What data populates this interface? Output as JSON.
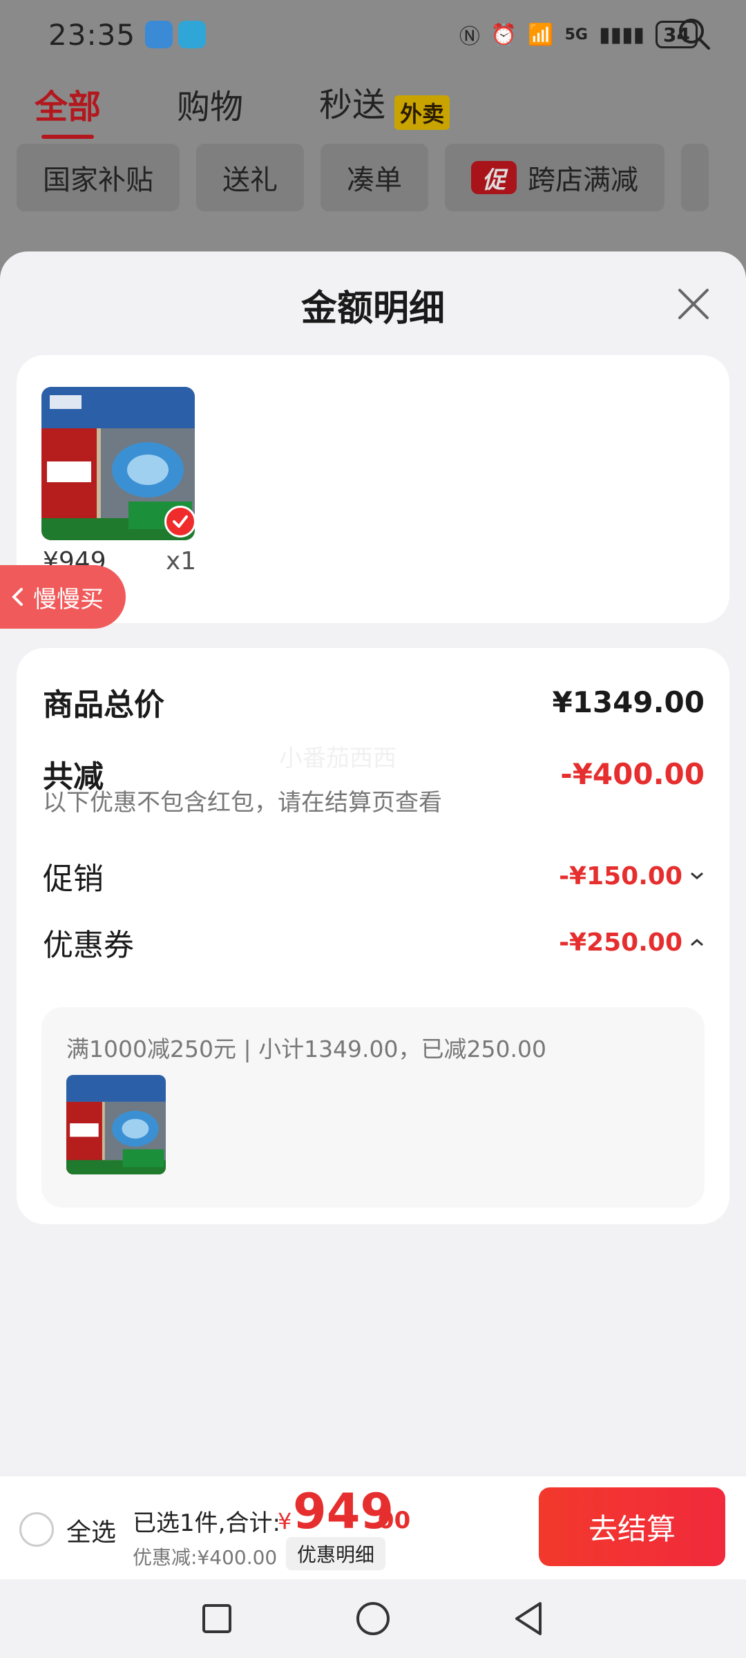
{
  "status_bar": {
    "time": "23:35",
    "network": "5G",
    "battery": "34"
  },
  "top_tabs": [
    {
      "label": "全部"
    },
    {
      "label": "购物"
    },
    {
      "label": "秒送"
    }
  ],
  "waimai_badge": "外卖",
  "chips": [
    {
      "label": "国家补贴"
    },
    {
      "label": "送礼"
    },
    {
      "label": "凑单"
    },
    {
      "label": "跨店满减"
    }
  ],
  "chip_promo_icon": "促",
  "sheet": {
    "title": "金额明细",
    "product": {
      "price": "¥949",
      "qty": "x1"
    },
    "slow_buy": "慢慢买",
    "rows": {
      "total_label": "商品总价",
      "total_value": "¥1349.00",
      "reduce_label": "共减",
      "reduce_value": "-¥400.00",
      "reduce_note": "以下优惠不包含红包，请在结算页查看",
      "promo_label": "促销",
      "promo_value": "-¥150.00",
      "coupon_label": "优惠券",
      "coupon_value": "-¥250.00"
    },
    "coupon_detail": "满1000减250元 | 小计1349.00，已减250.00",
    "watermark": "小番茄西西"
  },
  "bottom_bar": {
    "select_all": "全选",
    "selected_text": "已选1件,合计:",
    "currency": "¥",
    "total_int": "949",
    "total_dec": ".00",
    "discount_text": "优惠减:¥400.00",
    "discount_detail": "优惠明细",
    "checkout": "去结算"
  },
  "colors": {
    "accent": "#e62e2e",
    "active_tab": "#b2181e",
    "checkout_button": "#f2392c"
  },
  "icons": [
    "search-icon",
    "close-icon",
    "check-icon",
    "chevron-left-icon",
    "chevron-down-icon",
    "chevron-up-icon",
    "nav-recents-icon",
    "nav-home-icon",
    "nav-back-icon"
  ]
}
